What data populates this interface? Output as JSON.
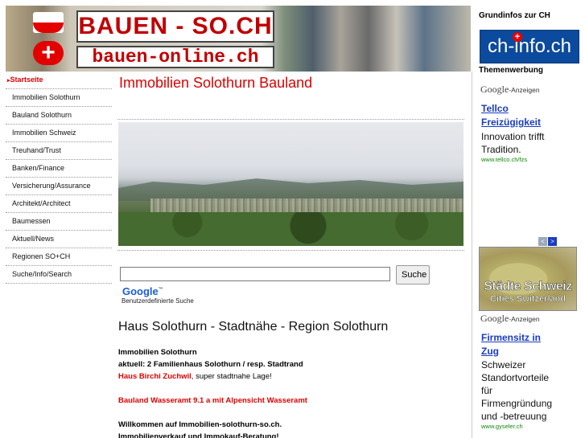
{
  "banner": {
    "site_name": "BAUEN - SO.CH",
    "site_url": "bauen-online.ch",
    "swiss_cross": "+"
  },
  "nav": {
    "items": [
      {
        "label": "Startseite",
        "active": true
      },
      {
        "label": "Immobilien Solothurn"
      },
      {
        "label": "Bauland Solothurn"
      },
      {
        "label": "Immobilien Schweiz"
      },
      {
        "label": "Treuhand/Trust"
      },
      {
        "label": "Banken/Finance"
      },
      {
        "label": "Versicherung/Assurance"
      },
      {
        "label": "Architekt/Architect"
      },
      {
        "label": "Baumessen"
      },
      {
        "label": "Aktuell/News"
      },
      {
        "label": "Regionen SO+CH"
      },
      {
        "label": "Suche/Info/Search"
      }
    ]
  },
  "main": {
    "title": "Immobilien Solothurn Bauland",
    "search": {
      "placeholder": "",
      "button_label": "Suche",
      "google_logo": "Google",
      "google_tm": "™",
      "custom_search_label": "Benutzerdefinierte Suche"
    },
    "section_title": "Haus Solothurn - Stadtnähe - Region Solothurn",
    "p1_line1": "Immobilien Solothurn",
    "p1_line2": "aktuell: 2 Familienhaus Solothurn / resp. Stadtrand",
    "p1_line3_link": "Haus Birchi Zuchwil",
    "p1_line3_rest": ", super stadtnahe Lage!",
    "bauland_link": "Bauland Wasseramt 9.1 a mit Alpensicht Wasseramt",
    "welcome_line1": "Willkommen auf Immobilien-solothurn-so.ch.",
    "welcome_line2": "Immobilienverkauf und Immokauf-Beratung!"
  },
  "right": {
    "heading": "Grundinfos zur CH",
    "chinfo_logo": "ch-info.ch",
    "chinfo_cross": "+",
    "werbung": "Themenwerbung",
    "google_ads_word": "Google",
    "google_ads_suffix": "-Anzeigen",
    "ad1": {
      "link_l1": "Tellco",
      "link_l2": "Freizügigkeit",
      "text_l1": "Innovation trifft",
      "text_l2": "Tradition.",
      "url": "www.tellco.ch/fzs"
    },
    "ad_nav_prev": "<",
    "ad_nav_next": ">",
    "cities_l1": "Städte Schweiz",
    "cities_l2": "Cities Switzerland",
    "ad2": {
      "link_l1": "Firmensitz in",
      "link_l2": "Zug",
      "text_l1": "Schweizer",
      "text_l2": "Standortvorteile",
      "text_l3": "für",
      "text_l4": "Firmengründung",
      "text_l5": "und -betreuung",
      "url": "www.gyseler.ch"
    }
  }
}
